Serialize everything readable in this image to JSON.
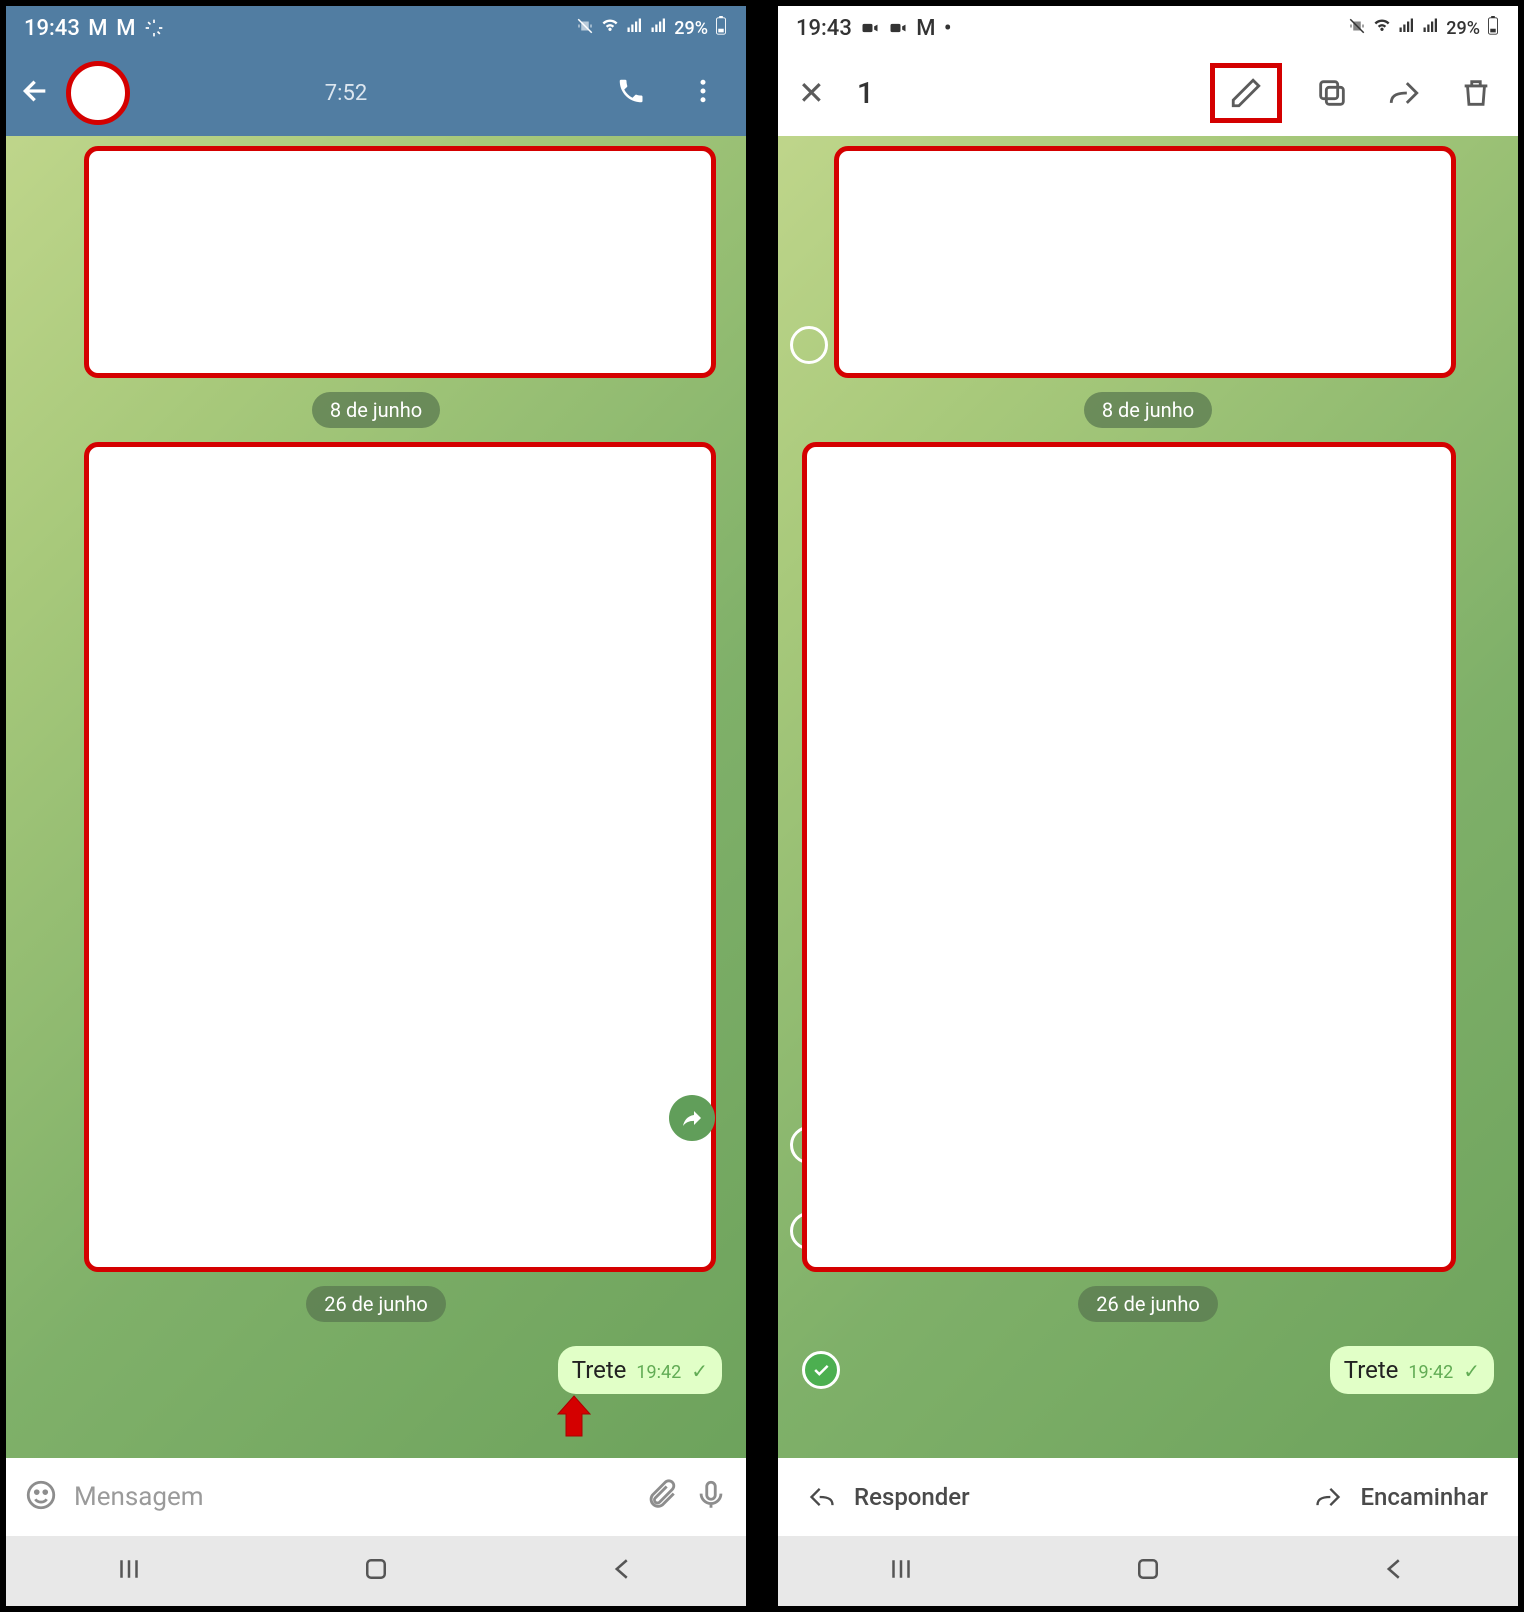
{
  "left": {
    "status_time": "19:43",
    "battery": "29%",
    "header_time": "7:52",
    "date1": "8 de junho",
    "date2": "26 de junho",
    "message_text": "Trete",
    "message_time": "19:42",
    "composer_placeholder": "Mensagem"
  },
  "right": {
    "status_time": "19:43",
    "battery": "29%",
    "sel_count": "1",
    "date1": "8 de junho",
    "date2": "26 de junho",
    "message_text": "Trete",
    "message_time": "19:42",
    "reply_label": "Responder",
    "forward_label": "Encaminhar"
  }
}
